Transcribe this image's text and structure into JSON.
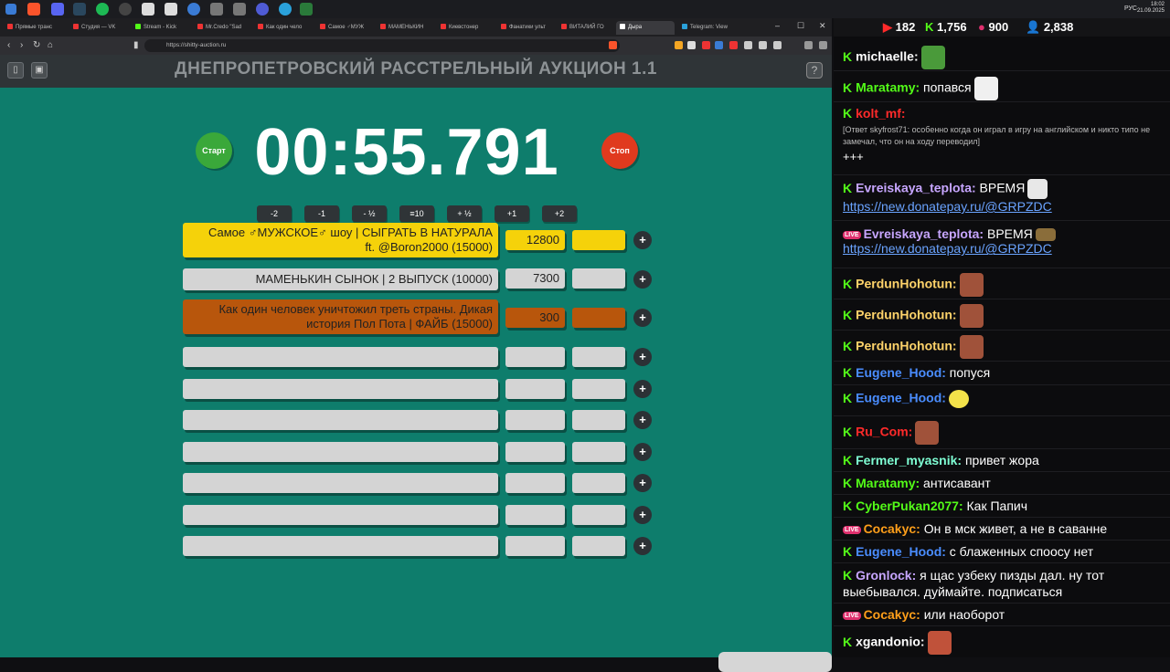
{
  "taskbar": {
    "lang": "РУС",
    "time": "18:02",
    "date": "21.09.2025"
  },
  "browser": {
    "tabs": [
      {
        "label": "Прямые транс"
      },
      {
        "label": "Студия — VK"
      },
      {
        "label": "Stream - Kick"
      },
      {
        "label": "Mr.Credo \"Sad"
      },
      {
        "label": "Как один чело"
      },
      {
        "label": "Самое ♂МУЖ"
      },
      {
        "label": "МАМЕНЬКИН"
      },
      {
        "label": "Киевстонер"
      },
      {
        "label": "Фанатики ульт"
      },
      {
        "label": "ВИТАЛИЙ ГО"
      },
      {
        "label": "Дыра"
      },
      {
        "label": "Telegram: View"
      }
    ],
    "url": "https://shitty-auction.ru"
  },
  "page": {
    "title": "ДНЕПРОПЕТРОВСКИЙ РАССТРЕЛЬНЫЙ АУКЦИОН 1.1",
    "help": "?",
    "start_label": "Старт",
    "stop_label": "Стоп",
    "timer": "00:55.791",
    "adjust": [
      "-2",
      "-1",
      "- ½",
      "≡10",
      "+ ½",
      "+1",
      "+2"
    ],
    "lots": [
      {
        "name": "Самое ♂МУЖСКОЕ♂ шоу | СЫГРАТЬ В НАТУРАЛА ft. @Boron2000 (15000)",
        "amount": "12800",
        "color": "#f5d20a"
      },
      {
        "name": "МАМЕНЬКИН СЫНОК | 2 ВЫПУСК (10000)",
        "amount": "7300",
        "color": "#d4d4d4"
      },
      {
        "name": "Как один человек уничтожил треть страны. Дикая история Пол Пота | ФАЙБ (15000)",
        "amount": "300",
        "color": "#b8560c"
      }
    ],
    "plus": "+"
  },
  "chat": {
    "stats": {
      "youtube": "182",
      "kick": "1,756",
      "vk": "900",
      "viewers": "2,838"
    },
    "messages": [
      {
        "user": "michaelle:",
        "text": "",
        "color": "#ffffff",
        "emote": "#4a9a3a"
      },
      {
        "user": "Maratamy:",
        "text": "попався",
        "color": "#53fc18",
        "emote": "#ffffff"
      },
      {
        "user": "kolt_mf:",
        "text": "",
        "color": "#ff2a2a",
        "reply": "[Ответ skyfrost71: особенно когда он играл в игру на английском и никто типо не замечал, что он на ходу переводил]",
        "extra": "+++"
      },
      {
        "user": "Evreiskaya_teplota:",
        "text": "ВРЕМЯ",
        "color": "#c7a6ff",
        "link": "https://new.donatepay.ru/@GRPZDC"
      },
      {
        "user": "Evreiskaya_teplota:",
        "text": "ВРЕМЯ",
        "color": "#c7a6ff",
        "link": "https://new.donatepay.ru/@GRPZDC"
      },
      {
        "user": "PerdunHohotun:",
        "text": "",
        "color": "#ffd36a"
      },
      {
        "user": "PerdunHohotun:",
        "text": "",
        "color": "#ffd36a"
      },
      {
        "user": "PerdunHohotun:",
        "text": "",
        "color": "#ffd36a"
      },
      {
        "user": "Eugene_Hood:",
        "text": "попуся",
        "color": "#4a8dff"
      },
      {
        "user": "Eugene_Hood:",
        "text": "",
        "color": "#4a8dff"
      },
      {
        "user": "Ru_Com:",
        "text": "",
        "color": "#ff2a2a"
      },
      {
        "user": "Fermer_myasnik:",
        "text": "привет жора",
        "color": "#7fffd4"
      },
      {
        "user": "Maratamy:",
        "text": "антисавант",
        "color": "#53fc18"
      },
      {
        "user": "CyberPukan2077:",
        "text": "Как Папич",
        "color": "#53fc18"
      },
      {
        "user": "Cocakyc:",
        "text": "Он в мск живет, а не в саванне",
        "color": "#ff9f1a"
      },
      {
        "user": "Eugene_Hood:",
        "text": "с блаженных споосу нет",
        "color": "#4a8dff"
      },
      {
        "user": "Gronlock:",
        "text": "я щас узбеку пизды дал. ну тот выебывался. дуймайте. подписаться",
        "color": "#c7a6ff"
      },
      {
        "user": "Cocakyc:",
        "text": "или наоборот",
        "color": "#ff9f1a"
      },
      {
        "user": "xgandonio:",
        "text": "",
        "color": "#ffffff"
      }
    ]
  }
}
